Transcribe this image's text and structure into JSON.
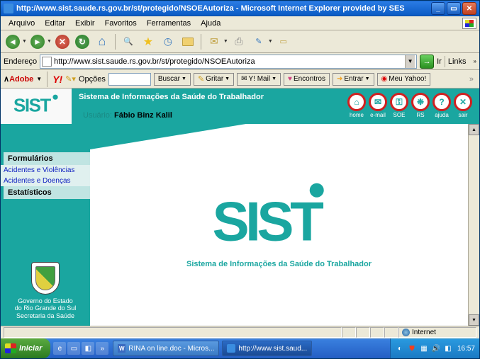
{
  "window": {
    "title": "http://www.sist.saude.rs.gov.br/st/protegido/NSOEAutoriza - Microsoft Internet Explorer provided by SES"
  },
  "menu": {
    "arquivo": "Arquivo",
    "editar": "Editar",
    "exibir": "Exibir",
    "favoritos": "Favoritos",
    "ferramentas": "Ferramentas",
    "ajuda": "Ajuda"
  },
  "address": {
    "label": "Endereço",
    "url": "http://www.sist.saude.rs.gov.br/st/protegido/NSOEAutoriza",
    "go": "Ir",
    "links": "Links"
  },
  "yahoo": {
    "adobe": "Adobe",
    "y": "Y!",
    "opcoes": "Opções",
    "buscar": "Buscar",
    "gritar": "Gritar",
    "ymail": "Y! Mail",
    "encontros": "Encontros",
    "entrar": "Entrar",
    "meu": "Meu Yahoo!"
  },
  "app": {
    "banner": "Sistema de Informações da Saúde do Trabalhador",
    "user_label": "Usuário:",
    "user_name": "Fábio Binz Kalil",
    "tagline": "Sistema de Informações da Saúde do Trabalhador"
  },
  "circlenav": {
    "home": "home",
    "email": "e-mail",
    "soe": "SOE",
    "rs": "RS",
    "ajuda": "ajuda",
    "sair": "sair"
  },
  "sidebar": {
    "formularios": "Formulários",
    "link1": "Acidentes e Violências",
    "link2": "Acidentes e Doenças",
    "estatisticos": "Estatísticos"
  },
  "gov": {
    "line1": "Governo do Estado",
    "line2": "do Rio Grande do Sul",
    "line3": "Secretaria da Saúde"
  },
  "status": {
    "zone": "Internet"
  },
  "taskbar": {
    "start": "Iniciar",
    "task1": "RINA on line.doc - Micros...",
    "task2": "http://www.sist.saud...",
    "clock": "16:57"
  }
}
